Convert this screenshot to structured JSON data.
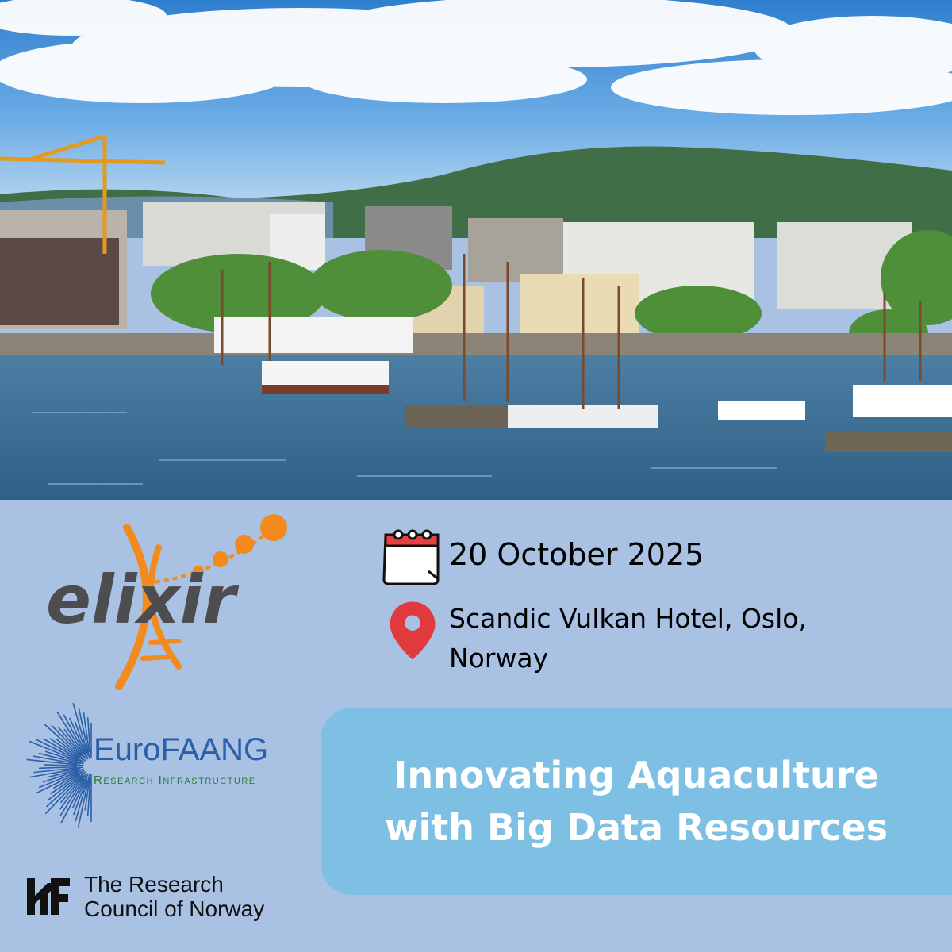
{
  "event": {
    "date": "20 October 2025",
    "location_line1": "Scandic Vulkan Hotel, Oslo,",
    "location_line2": "Norway",
    "title_line1": "Innovating Aquaculture",
    "title_line2": "with Big Data Resources"
  },
  "logos": {
    "elixir": "elixir",
    "eurofaang_name": "EuroFAANG",
    "eurofaang_sub": "Research Infrastructure",
    "rcn_line1": "The Research",
    "rcn_line2": "Council of Norway"
  },
  "icons": [
    "calendar-icon",
    "location-pin-icon"
  ],
  "colors": {
    "background": "#a9c1e3",
    "banner": "#7dc0e4",
    "elixir_orange": "#f28a1e",
    "elixir_grey": "#4d4d4f",
    "eurofaang_blue": "#2b5fa8",
    "pin_red": "#e0393e",
    "calendar_red": "#e64040"
  }
}
